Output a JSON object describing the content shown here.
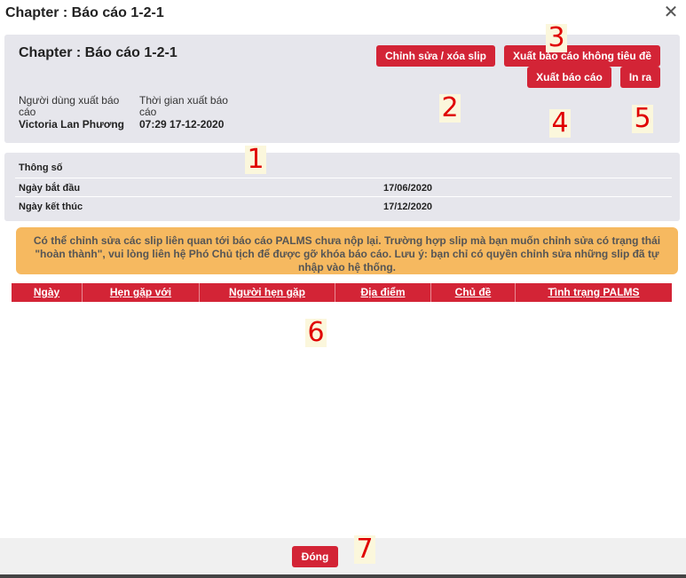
{
  "dialog": {
    "title": "Chapter : Báo cáo 1-2-1",
    "close_icon": "close-icon"
  },
  "report": {
    "heading": "Chapter : Báo cáo 1-2-1",
    "exported_by_label": "Người dùng xuất báo cáo",
    "exported_by_value": "Victoria Lan Phương",
    "export_time_label": "Thời gian xuất báo cáo",
    "export_time_value": "07:29 17-12-2020"
  },
  "actions": {
    "edit_slip": "Chỉnh sửa / xóa slip",
    "export_no_header": "Xuất báo cáo không tiêu đề",
    "export": "Xuất báo cáo",
    "print": "In ra"
  },
  "params": {
    "title": "Thông số",
    "rows": [
      {
        "label": "Ngày bắt đầu",
        "value": "17/06/2020"
      },
      {
        "label": "Ngày kết thúc",
        "value": "17/12/2020"
      }
    ]
  },
  "notice": "Có thể chỉnh sửa các slip liên quan tới báo cáo PALMS chưa nộp lại. Trường hợp slip mà bạn muốn chỉnh sửa có trạng thái \"hoàn thành\", vui lòng liên hệ Phó Chủ tịch để được gỡ khóa báo cáo. Lưu ý: bạn chỉ có quyền chỉnh sửa những slip đã tự nhập vào hệ thống.",
  "table": {
    "columns": [
      "Ngày",
      "Hẹn gặp với",
      "Người hẹn gặp",
      "Địa điểm",
      "Chủ đề",
      "Tình trạng PALMS"
    ],
    "rows": []
  },
  "footer": {
    "close": "Đóng"
  },
  "callouts": [
    "1",
    "2",
    "3",
    "4",
    "5",
    "6",
    "7"
  ],
  "colors": {
    "accent_red": "#d32436",
    "panel_bg": "#e6e6ec",
    "notice_bg": "#f6b960",
    "callout_text": "#e00000"
  }
}
